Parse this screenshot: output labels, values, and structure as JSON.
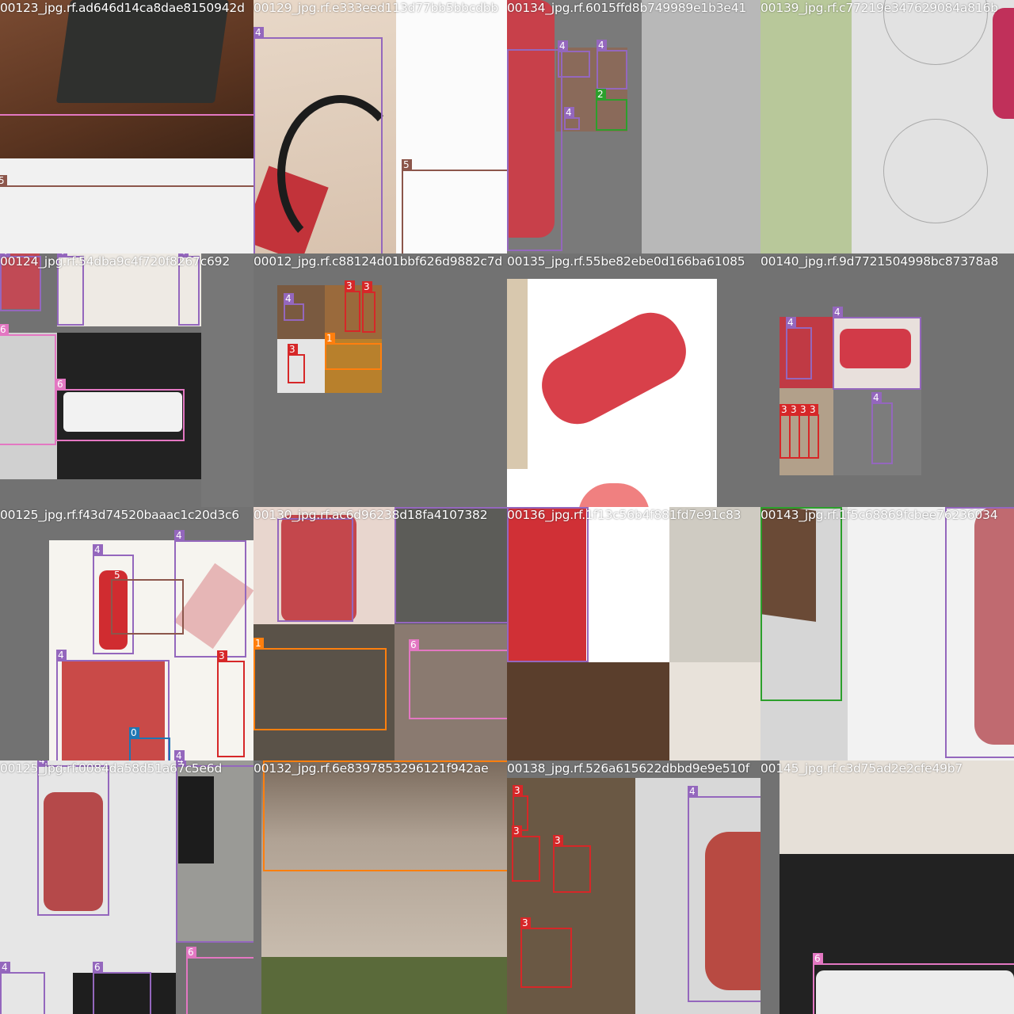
{
  "mosaic": {
    "class_colors": {
      "0": "#1f77b4",
      "1": "#ff7f0e",
      "2": "#2ca02c",
      "3": "#d62728",
      "4": "#9467bd",
      "5": "#8c564b",
      "6": "#e377c2"
    },
    "tiles": [
      {
        "filename": "00123_jpg.rf.ad646d14ca8dae8150942d"
      },
      {
        "filename": "00129_jpg.rf.e333eed113d77bb5bbcdbb"
      },
      {
        "filename": "00134_jpg.rf.6015ffd8b749989e1b3e41"
      },
      {
        "filename": "00139_jpg.rf.c77219e347629084a816b"
      },
      {
        "filename": "00124_jpg.rf.54dba9c4f720f8267c692"
      },
      {
        "filename": "00012_jpg.rf.c88124d01bbf626d9882c7d"
      },
      {
        "filename": "00135_jpg.rf.55be82ebe0d166ba61085"
      },
      {
        "filename": "00140_jpg.rf.9d7721504998bc87378a8"
      },
      {
        "filename": "00125_jpg.rf.f43d74520baaac1c20d3c6"
      },
      {
        "filename": "00130_jpg.rf.ac6d96238d18fa4107382"
      },
      {
        "filename": "00136_jpg.rf.1f13c56b4f881fd7e91c83"
      },
      {
        "filename": "00143_jpg.rf.1f5c68869fcbee76236034"
      },
      {
        "filename": "00125_jpg.rf.0084da58d51a67c5e6d"
      },
      {
        "filename": "00132_jpg.rf.6e8397853296121f942ae"
      },
      {
        "filename": "00138_jpg.rf.526a615622dbbd9e9e510f"
      },
      {
        "filename": "00145_jpg.rf.c3d75ad2e2cfe49b7"
      }
    ],
    "detections": [
      {
        "class": "4"
      },
      {
        "class": "5"
      },
      {
        "class": "5"
      },
      {
        "class": "4"
      },
      {
        "class": "4"
      },
      {
        "class": "2"
      },
      {
        "class": "4"
      },
      {
        "class": "4"
      },
      {
        "class": "4"
      },
      {
        "class": "4"
      },
      {
        "class": "6"
      },
      {
        "class": "6"
      },
      {
        "class": "4"
      },
      {
        "class": "3"
      },
      {
        "class": "3"
      },
      {
        "class": "3"
      },
      {
        "class": "1"
      },
      {
        "class": "4"
      },
      {
        "class": "4"
      },
      {
        "class": "4"
      },
      {
        "class": "3"
      },
      {
        "class": "3"
      },
      {
        "class": "3"
      },
      {
        "class": "3"
      },
      {
        "class": "4"
      },
      {
        "class": "4"
      },
      {
        "class": "5"
      },
      {
        "class": "4"
      },
      {
        "class": "3"
      },
      {
        "class": "0"
      },
      {
        "class": "4"
      },
      {
        "class": "4"
      },
      {
        "class": "4"
      },
      {
        "class": "1"
      },
      {
        "class": "6"
      },
      {
        "class": "4"
      },
      {
        "class": "4"
      },
      {
        "class": "2"
      },
      {
        "class": "4"
      },
      {
        "class": "4"
      },
      {
        "class": "4"
      },
      {
        "class": "4"
      },
      {
        "class": "6"
      },
      {
        "class": "1"
      },
      {
        "class": "1"
      },
      {
        "class": "3"
      },
      {
        "class": "3"
      },
      {
        "class": "3"
      },
      {
        "class": "3"
      },
      {
        "class": "4"
      },
      {
        "class": "6"
      }
    ]
  }
}
